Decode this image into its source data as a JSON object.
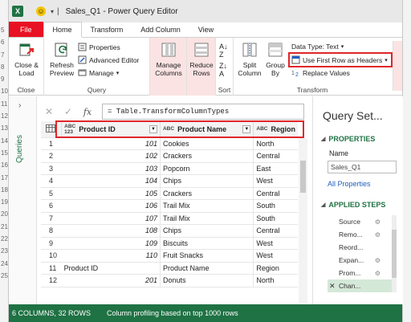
{
  "app": {
    "window_title": "Sales_Q1 - Power Query Editor",
    "logo_letter": "X"
  },
  "excel_row_numbers": [
    "5",
    "6",
    "7",
    "8",
    "9",
    "10",
    "11",
    "12",
    "13",
    "14",
    "15",
    "16",
    "17",
    "18",
    "19",
    "20",
    "21",
    "22",
    "23",
    "24",
    "25"
  ],
  "tabs": [
    {
      "label": "File"
    },
    {
      "label": "Home"
    },
    {
      "label": "Transform"
    },
    {
      "label": "Add Column"
    },
    {
      "label": "View"
    }
  ],
  "ribbon": {
    "close_load": "Close &\nLoad",
    "close_group": "Close",
    "refresh_preview": "Refresh\nPreview",
    "properties": "Properties",
    "advanced_editor": "Advanced Editor",
    "manage": "Manage",
    "query_group": "Query",
    "manage_columns": "Manage\nColumns",
    "reduce_rows": "Reduce\nRows",
    "sort_group": "Sort",
    "split_column": "Split\nColumn",
    "group_by": "Group\nBy",
    "data_type": "Data Type: Text",
    "use_first_row": "Use First Row as Headers",
    "replace_values": "Replace Values",
    "transform_group": "Transform"
  },
  "formula": {
    "text": "= Table.TransformColumnTypes"
  },
  "grid": {
    "columns": [
      {
        "type": "ABC\n123",
        "name": "Product ID"
      },
      {
        "type": "ABC",
        "name": "Product Name"
      },
      {
        "type": "ABC",
        "name": "Region"
      }
    ],
    "rows": [
      {
        "n": "1",
        "id": "101",
        "name": "Cookies",
        "region": "North"
      },
      {
        "n": "2",
        "id": "102",
        "name": "Crackers",
        "region": "Central"
      },
      {
        "n": "3",
        "id": "103",
        "name": "Popcorn",
        "region": "East"
      },
      {
        "n": "4",
        "id": "104",
        "name": "Chips",
        "region": "West"
      },
      {
        "n": "5",
        "id": "105",
        "name": "Crackers",
        "region": "Central"
      },
      {
        "n": "6",
        "id": "106",
        "name": "Trail Mix",
        "region": "South"
      },
      {
        "n": "7",
        "id": "107",
        "name": "Trail Mix",
        "region": "South"
      },
      {
        "n": "8",
        "id": "108",
        "name": "Chips",
        "region": "Central"
      },
      {
        "n": "9",
        "id": "109",
        "name": "Biscuits",
        "region": "West"
      },
      {
        "n": "10",
        "id": "110",
        "name": "Fruit Snacks",
        "region": "West"
      },
      {
        "n": "11",
        "id": "Product ID",
        "name": "Product Name",
        "region": "Region"
      },
      {
        "n": "12",
        "id": "201",
        "name": "Donuts",
        "region": "North"
      }
    ]
  },
  "query_settings": {
    "title": "Query Set...",
    "properties": "PROPERTIES",
    "name_label": "Name",
    "name_value": "Sales_Q1",
    "all_properties": "All Properties",
    "applied_steps": "APPLIED STEPS",
    "steps": [
      "Source",
      "Remo...",
      "Reord...",
      "Expan...",
      "Prom...",
      "Chan..."
    ]
  },
  "queries_label": "Queries",
  "status": {
    "columns_rows": "6 COLUMNS, 32 ROWS",
    "profiling": "Column profiling based on top 1000 rows"
  }
}
